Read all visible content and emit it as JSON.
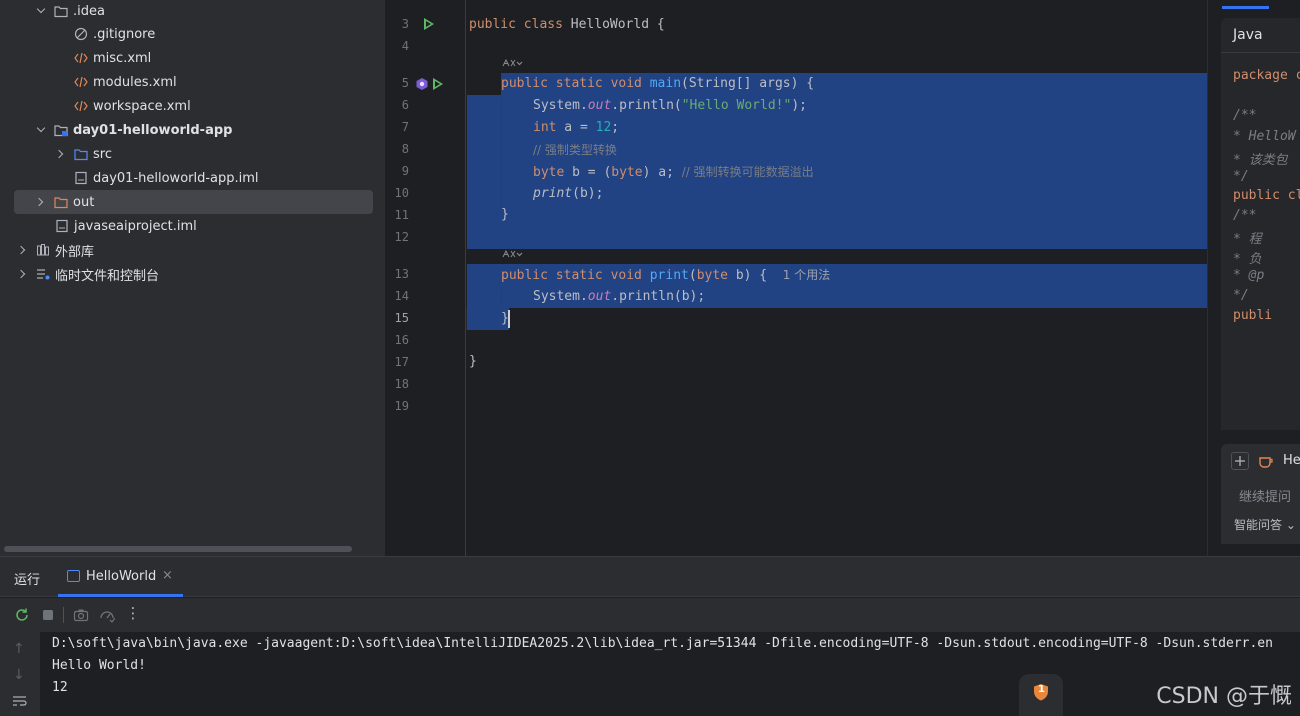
{
  "project_tree": {
    "items": [
      {
        "label": ".idea",
        "type": "folder",
        "expanded": true,
        "bold": false
      },
      {
        "label": ".gitignore",
        "type": "ignore-file"
      },
      {
        "label": "misc.xml",
        "type": "xml-file"
      },
      {
        "label": "modules.xml",
        "type": "xml-file"
      },
      {
        "label": "workspace.xml",
        "type": "xml-file"
      },
      {
        "label": "day01-helloworld-app",
        "type": "module-folder",
        "expanded": true,
        "bold": true
      },
      {
        "label": "src",
        "type": "source-folder",
        "expanded": false
      },
      {
        "label": "day01-helloworld-app.iml",
        "type": "iml-file"
      },
      {
        "label": "out",
        "type": "excluded-folder",
        "expanded": false,
        "selected": true
      },
      {
        "label": "javaseaiproject.iml",
        "type": "iml-file"
      },
      {
        "label": "外部库",
        "type": "library",
        "expanded": false
      },
      {
        "label": "临时文件和控制台",
        "type": "scratches",
        "expanded": false
      }
    ]
  },
  "editor": {
    "line_numbers": [
      "3",
      "4",
      "5",
      "6",
      "7",
      "8",
      "9",
      "10",
      "11",
      "12",
      "13",
      "14",
      "15",
      "16",
      "17",
      "18",
      "19"
    ],
    "current_line": "15",
    "code": {
      "l3_kw1": "public",
      "l3_kw2": "class",
      "l3_rest": " HelloWorld {",
      "l5_kw": "public static void ",
      "l5_fn": "main",
      "l5_rest": "(String[] args) {",
      "l6_a": "System.",
      "l6_out": "out",
      "l6_b": ".println(",
      "l6_str": "\"Hello World!\"",
      "l6_c": ");",
      "l7_kw": "int",
      "l7_a": " a = ",
      "l7_num": "12",
      "l7_b": ";",
      "l8_cm": "// 强制类型转换",
      "l9_kw": "byte",
      "l9_a": " b = (",
      "l9_kw2": "byte",
      "l9_b": ") a; ",
      "l9_cm": "// 强制转换可能数据溢出",
      "l10_fn": "print",
      "l10_rest": "(b);",
      "l11": "}",
      "l13_kw": "public static void ",
      "l13_fn": "print",
      "l13_a": "(",
      "l13_kw2": "byte",
      "l13_b": " b) {",
      "l13_hint": "1 个用法",
      "l14_a": "System.",
      "l14_out": "out",
      "l14_b": ".println(b);",
      "l15": "}",
      "l17": "}"
    }
  },
  "right_panel": {
    "tab_label": "Java",
    "preview_lines": [
      "package c",
      "/**",
      " * HelloW",
      " * 该类包",
      " */",
      "public cl",
      "    /**",
      "     * 程",
      "     * 负",
      "     * @p",
      "     */",
      "    publi"
    ],
    "chat_tab": "He",
    "input_placeholder": "继续提问",
    "mode_label": "智能问答"
  },
  "run_window": {
    "title": "运行",
    "tab_label": "HelloWorld",
    "console_lines": [
      "D:\\soft\\java\\bin\\java.exe -javaagent:D:\\soft\\idea\\IntelliJIDEA2025.2\\lib\\idea_rt.jar=51344 -Dfile.encoding=UTF-8 -Dsun.stdout.encoding=UTF-8 -Dsun.stderr.en",
      "Hello World!",
      "12"
    ],
    "notification_count": "1"
  },
  "watermark": "CSDN @于慨"
}
